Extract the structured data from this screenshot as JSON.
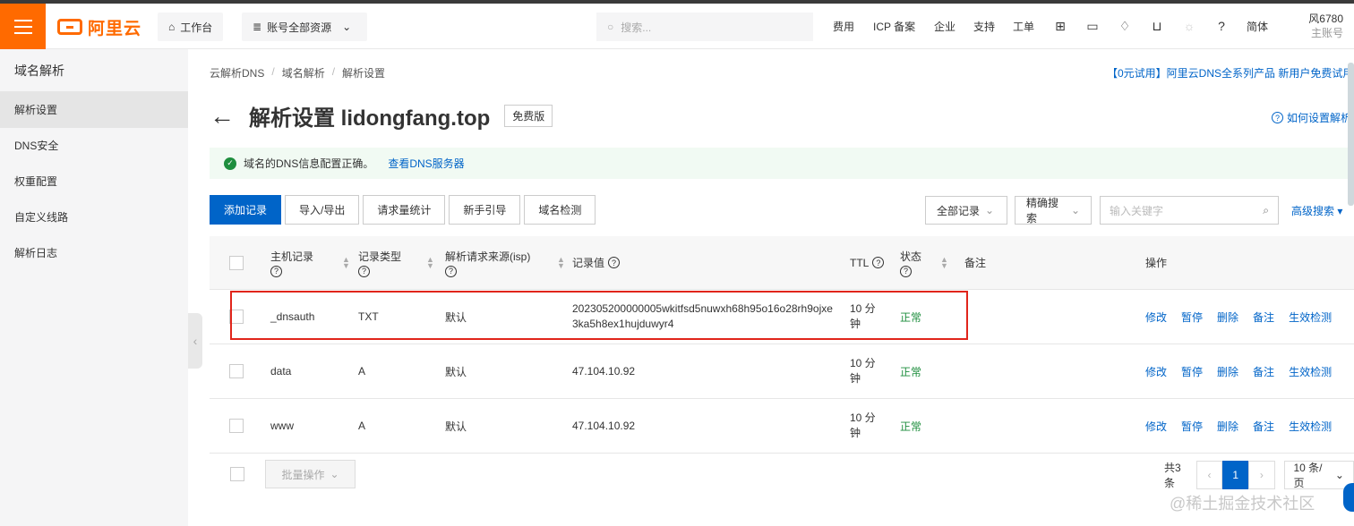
{
  "topbar": {
    "logo_text": "阿里云",
    "workbench": "工作台",
    "resources": "账号全部资源",
    "search_placeholder": "搜索...",
    "nav": [
      "费用",
      "ICP 备案",
      "企业",
      "支持",
      "工单"
    ],
    "lang": "简体",
    "user_name": "风6780",
    "user_sub": "主账号"
  },
  "sidebar": {
    "title": "域名解析",
    "items": [
      "解析设置",
      "DNS安全",
      "权重配置",
      "自定义线路",
      "解析日志"
    ]
  },
  "breadcrumb": [
    "云解析DNS",
    "域名解析",
    "解析设置"
  ],
  "promo": "【0元试用】阿里云DNS全系列产品 新用户免费试用",
  "page": {
    "title": "解析设置 lidongfang.top",
    "badge": "免费版",
    "help": "如何设置解析"
  },
  "alert": {
    "text": "域名的DNS信息配置正确。",
    "link": "查看DNS服务器"
  },
  "toolbar": {
    "buttons": [
      "添加记录",
      "导入/导出",
      "请求量统计",
      "新手引导",
      "域名检测"
    ],
    "filter_all": "全部记录",
    "precise": "精确搜索",
    "keyword_placeholder": "输入关键字",
    "advanced": "高级搜索"
  },
  "table": {
    "headers": {
      "host": "主机记录",
      "type": "记录类型",
      "isp": "解析请求来源(isp)",
      "value": "记录值",
      "ttl": "TTL",
      "status": "状态",
      "remark": "备注",
      "ops": "操作"
    },
    "rows": [
      {
        "host": "_dnsauth",
        "type": "TXT",
        "isp": "默认",
        "value": "202305200000005wkitfsd5nuwxh68h95o16o28rh9ojxe3ka5h8ex1hujduwyr4",
        "ttl": "10 分钟",
        "status": "正常"
      },
      {
        "host": "data",
        "type": "A",
        "isp": "默认",
        "value": "47.104.10.92",
        "ttl": "10 分钟",
        "status": "正常"
      },
      {
        "host": "www",
        "type": "A",
        "isp": "默认",
        "value": "47.104.10.92",
        "ttl": "10 分钟",
        "status": "正常"
      }
    ],
    "ops": [
      "修改",
      "暂停",
      "删除",
      "备注",
      "生效检测"
    ]
  },
  "footer": {
    "batch": "批量操作",
    "total": "共3条",
    "current_page": "1",
    "page_size": "10 条/页"
  },
  "watermark": "@稀土掘金技术社区",
  "colors": {
    "brand": "#ff6a00",
    "primary": "#0064c8",
    "success": "#1e8e3e",
    "highlight": "#e1251b"
  }
}
